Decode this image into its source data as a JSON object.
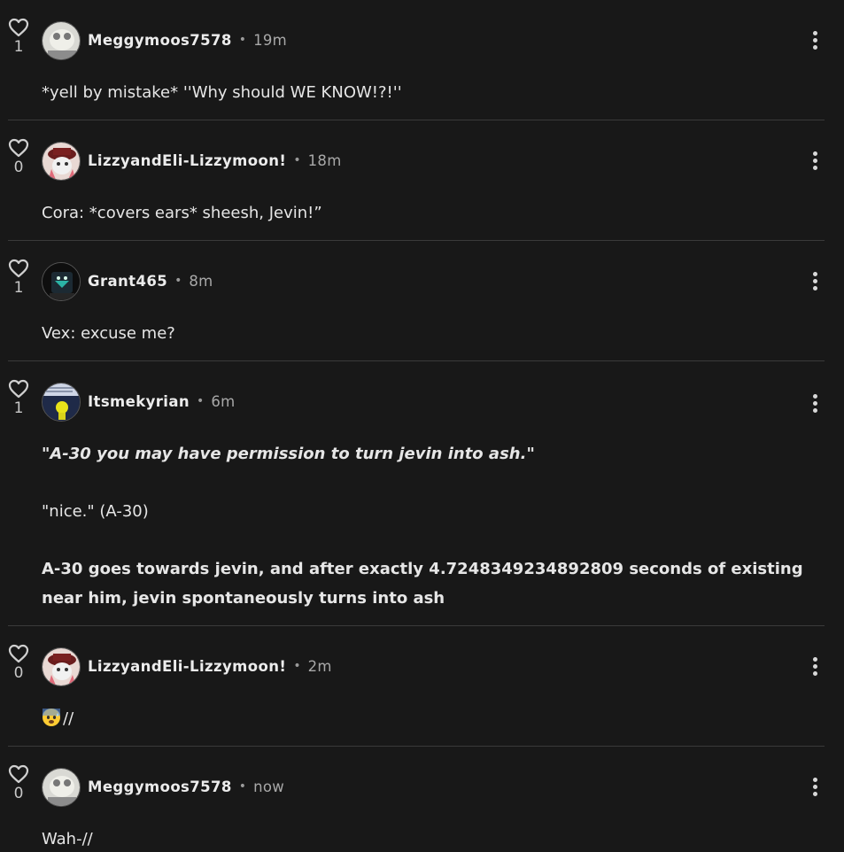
{
  "comments": [
    {
      "likes": "1",
      "username": "Meggymoos7578",
      "time": "19m",
      "text": "*yell by mistake* ''Why should WE KNOW!?!''"
    },
    {
      "likes": "0",
      "username": "LizzyandEli-Lizzymoon!",
      "time": "18m",
      "text": "Cora: *covers ears* sheesh, Jevin!”"
    },
    {
      "likes": "1",
      "username": "Grant465",
      "time": "8m",
      "text": "Vex: excuse me?"
    },
    {
      "likes": "1",
      "username": "Itsmekyrian",
      "time": "6m",
      "line1": "\"A-30 you may have permission to turn jevin into ash.\"",
      "line2": "\"nice.\" (A-30)",
      "line3a": "A-30 goes towards jevin, and after exactly 4.7248349234892809 seconds of existing",
      "line3b": "near him, jevin spontaneously turns into ash"
    },
    {
      "likes": "0",
      "username": "LizzyandEli-Lizzymoon!",
      "time": "2m",
      "emoji": "anxious-face-with-sweat",
      "text": "//"
    },
    {
      "likes": "0",
      "username": "Meggymoos7578",
      "time": "now",
      "text": "Wah-//"
    }
  ],
  "separator": "•",
  "colors": {
    "background": "#181818",
    "divider": "#3a3a3a",
    "text": "#e6e6e6",
    "muted": "#a8a8a8"
  },
  "icons": [
    "heart-icon",
    "more-vertical-icon",
    "avatar"
  ]
}
